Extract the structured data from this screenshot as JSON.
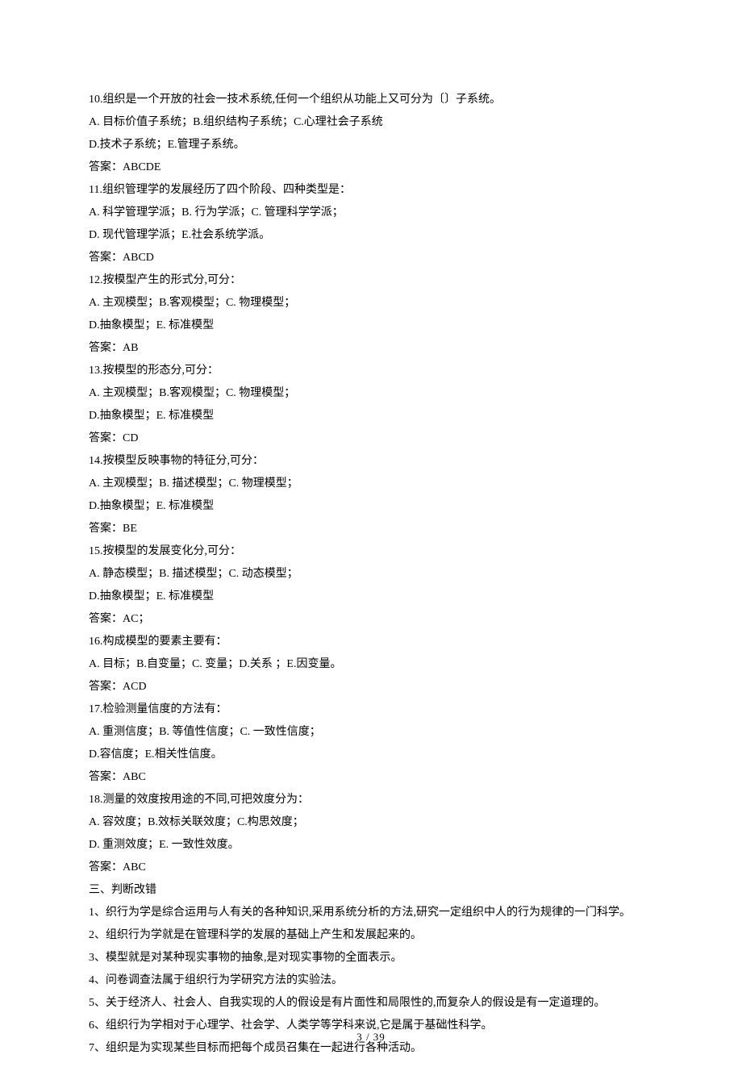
{
  "lines": [
    "10.组织是一个开放的社会一技术系统,任何一个组织从功能上又可分为〔〕子系统。",
    "A. 目标价值子系统；B.组织结构子系统；C.心理社会子系统",
    "D.技术子系统；E.管理子系统。",
    "答案：ABCDE",
    "11.组织管理学的发展经历了四个阶段、四种类型是：",
    "A. 科学管理学派；B. 行为学派；C. 管理科学学派；",
    "D. 现代管理学派；E.社会系统学派。",
    "答案：ABCD",
    "12.按模型产生的形式分,可分：",
    "A. 主观模型；B.客观模型；C. 物理模型；",
    "D.抽象模型；E. 标准模型",
    "答案：AB",
    "13.按模型的形态分,可分：",
    "A. 主观模型；B.客观模型；C. 物理模型；",
    "D.抽象模型；E. 标准模型",
    "答案：CD",
    "14.按模型反映事物的特征分,可分：",
    "A. 主观模型；B. 描述模型；C. 物理模型；",
    "D.抽象模型；E. 标准模型",
    "答案：BE",
    "15.按模型的发展变化分,可分：",
    "A. 静态模型；B. 描述模型；C. 动态模型；",
    "D.抽象模型；E. 标准模型",
    "答案：AC；",
    "16.构成模型的要素主要有：",
    "A. 目标；B.自变量；C. 变量；D.关系 ；E.因变量。",
    "答案：ACD",
    "17.检验测量信度的方法有：",
    "A. 重测信度；B. 等值性信度；C. 一致性信度；",
    "D.容信度；E.相关性信度。",
    "答案：ABC",
    "18.测量的效度按用途的不同,可把效度分为：",
    "A. 容效度；B.效标关联效度；C.构思效度；",
    "D. 重测效度；E. 一致性效度。",
    "答案：ABC",
    "三、判断改错",
    "1、织行为学是综合运用与人有关的各种知识,采用系统分析的方法,研究一定组织中人的行为规律的一门科学。",
    "2、组织行为学就是在管理科学的发展的基础上产生和发展起来的。",
    "3、模型就是对某种现实事物的抽象,是对现实事物的全面表示。",
    "4、问卷调查法属于组织行为学研究方法的实验法。",
    "5、关于经济人、社会人、自我实现的人的假设是有片面性和局限性的,而复杂人的假设是有一定道理的。",
    "6、组织行为学相对于心理学、社会学、人类学等学科来说,它是属于基础性科学。",
    "7、组织是为实现某些目标而把每个成员召集在一起进行各种活动。"
  ],
  "footer": "3 / 39"
}
